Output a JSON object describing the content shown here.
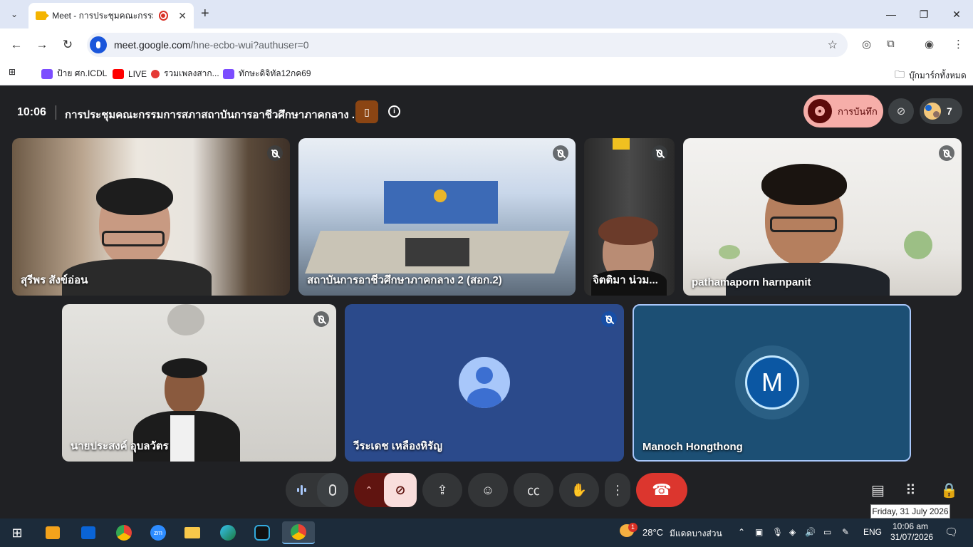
{
  "browser": {
    "tab_title": "Meet - การประชุมคณะกรรมการ",
    "url_host": "meet.google.com",
    "url_path": "/hne-ecbo-wui?authuser=0",
    "bookmarks": [
      "ป้าย ศก.ICDL",
      "LIVE",
      "รวมเพลงสาก...",
      "ทักษะดิจิทัล12กค69"
    ],
    "all_bookmarks": "บุ๊กมาร์กทั้งหมด"
  },
  "meet": {
    "time": "10:06",
    "title": "การประชุมคณะกรรมการสภาสถาบันการอาชีวศึกษาภาคกลาง ...",
    "record_label": "การบันทึก",
    "participant_count": "7",
    "tiles": [
      {
        "name": "สุรีพร สังข์อ่อน",
        "muted": true
      },
      {
        "name": "สถาบันการอาชีวศึกษาภาคกลาง 2 (สอก.2)",
        "muted": true
      },
      {
        "name": "จิตติมา น่วม...",
        "muted": true
      },
      {
        "name": "pathamaporn harnpanit",
        "muted": true
      },
      {
        "name": "นายประสงค์ อุบลวัตร",
        "muted": true
      },
      {
        "name": "วีระเดช เหลืองหิรัญ",
        "muted": true
      },
      {
        "name": "Manoch Hongthong",
        "muted": false,
        "initial": "M"
      }
    ]
  },
  "taskbar": {
    "weather_temp": "28°C",
    "weather_desc": "มีแดดบางส่วน",
    "weather_badge": "1",
    "lang": "ENG",
    "clock_time": "10:06 am",
    "clock_date": "31/07/2026",
    "date_tooltip": "Friday, 31 July 2026",
    "zoom_label": "zm"
  },
  "colors": {
    "meet_bg": "#202124",
    "end_call": "#dc362e",
    "record_pill": "#f6aea9",
    "active_speaker_border": "#a8c7fa"
  }
}
